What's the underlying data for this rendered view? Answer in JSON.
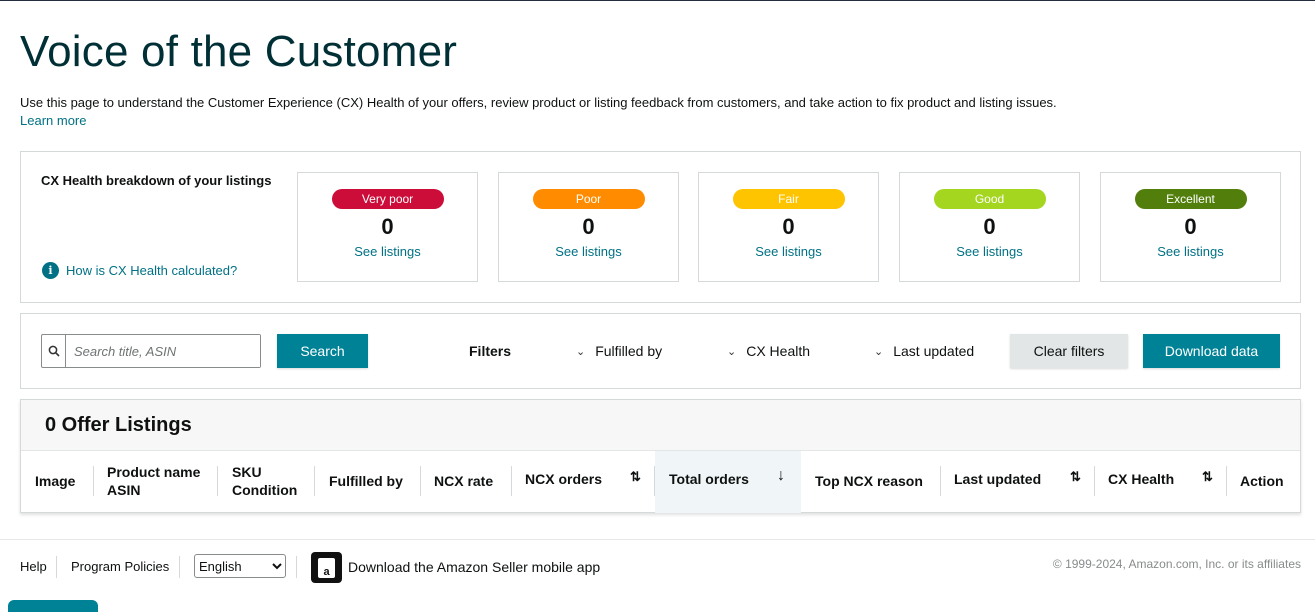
{
  "header": {
    "title": "Voice of the Customer",
    "intro": "Use this page to understand the Customer Experience (CX) Health of your offers, review product or listing feedback from customers, and take action to fix product and listing issues.",
    "learn_more": "Learn more"
  },
  "health": {
    "title": "CX Health breakdown of your listings",
    "help_link": "How is CX Health calculated?",
    "cards": [
      {
        "label": "Very poor",
        "count": "0",
        "link": "See listings",
        "color": "#cc0c39"
      },
      {
        "label": "Poor",
        "count": "0",
        "link": "See listings",
        "color": "#ff8c00"
      },
      {
        "label": "Fair",
        "count": "0",
        "link": "See listings",
        "color": "#ffc400"
      },
      {
        "label": "Good",
        "count": "0",
        "link": "See listings",
        "color": "#a4d51f"
      },
      {
        "label": "Excellent",
        "count": "0",
        "link": "See listings",
        "color": "#527f0c"
      }
    ]
  },
  "filters": {
    "search_placeholder": "Search title, ASIN",
    "search_button": "Search",
    "label": "Filters",
    "fulfilled_by": "Fulfilled by",
    "cx_health": "CX Health",
    "last_updated": "Last updated",
    "clear": "Clear filters",
    "download": "Download data"
  },
  "table": {
    "count_label": "0 Offer Listings",
    "columns": {
      "image": "Image",
      "product_name": "Product name",
      "asin": "ASIN",
      "sku": "SKU",
      "condition": "Condition",
      "fulfilled_by": "Fulfilled by",
      "ncx_rate": "NCX rate",
      "ncx_orders": "NCX orders",
      "total_orders": "Total orders",
      "top_ncx_reason": "Top NCX reason",
      "last_updated": "Last updated",
      "cx_health": "CX Health",
      "action": "Action"
    }
  },
  "footer": {
    "help": "Help",
    "policies": "Program Policies",
    "language": "English",
    "app_text": "Download the Amazon Seller mobile app",
    "copyright": "© 1999-2024, Amazon.com, Inc. or its affiliates"
  },
  "colors": {
    "accent": "#008296",
    "link": "#007185"
  }
}
